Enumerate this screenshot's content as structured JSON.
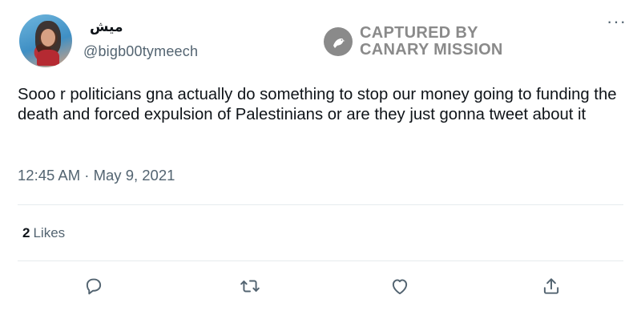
{
  "author": {
    "display_name": "ميش",
    "handle": "@bigb00tymeech"
  },
  "watermark": {
    "line1": "CAPTURED BY",
    "line2": "CANARY MISSION"
  },
  "menu": {
    "more_label": "···"
  },
  "tweet": {
    "text": "Sooo r politicians gna actually do something to stop our money going to funding the death and forced expulsion of Palestinians or are they just gonna tweet about it",
    "timestamp": "12:45 AM · May 9, 2021"
  },
  "stats": {
    "likes_count": "2",
    "likes_label": "Likes"
  },
  "actions": [
    {
      "icon": "reply-icon"
    },
    {
      "icon": "retweet-icon"
    },
    {
      "icon": "like-icon"
    },
    {
      "icon": "share-icon"
    }
  ],
  "colors": {
    "text": "#0f1419",
    "secondary": "#536471",
    "watermark": "#8a8a8a",
    "divider": "#e6ebee"
  }
}
